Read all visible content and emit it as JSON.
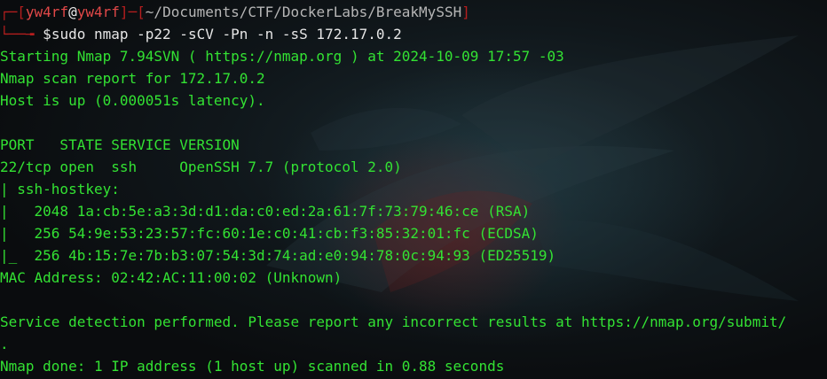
{
  "prompt": {
    "user": "yw4rf",
    "at": "@",
    "host": "yw4rf",
    "path": "~/Documents/CTF/DockerLabs/BreakMySSH",
    "symbol": "$",
    "command": "sudo nmap -p22 -sCV -Pn -n -sS 172.17.0.2"
  },
  "output": [
    "Starting Nmap 7.94SVN ( https://nmap.org ) at 2024-10-09 17:57 -03",
    "Nmap scan report for 172.17.0.2",
    "Host is up (0.000051s latency).",
    "",
    "PORT   STATE SERVICE VERSION",
    "22/tcp open  ssh     OpenSSH 7.7 (protocol 2.0)",
    "| ssh-hostkey: ",
    "|   2048 1a:cb:5e:a3:3d:d1:da:c0:ed:2a:61:7f:73:79:46:ce (RSA)",
    "|   256 54:9e:53:23:57:fc:60:1e:c0:41:cb:f3:85:32:01:fc (ECDSA)",
    "|_  256 4b:15:7e:7b:b3:07:54:3d:74:ad:e0:94:78:0c:94:93 (ED25519)",
    "MAC Address: 02:42:AC:11:00:02 (Unknown)",
    "",
    "Service detection performed. Please report any incorrect results at https://nmap.org/submit/",
    ".",
    "Nmap done: 1 IP address (1 host up) scanned in 0.88 seconds"
  ],
  "colors": {
    "output_text": "#33e233",
    "prompt_bracket": "#b51e1e",
    "prompt_user": "#e14848",
    "command_text": "#e6e6e6",
    "background": "#0b0d10"
  }
}
